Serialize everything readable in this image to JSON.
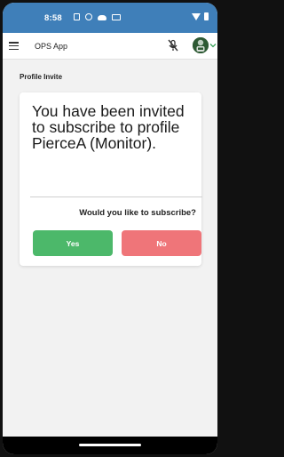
{
  "status_bar": {
    "time": "8:58",
    "icons": [
      "sim-icon",
      "circle-icon",
      "cloud-icon",
      "card-icon",
      "wifi-icon",
      "battery-icon"
    ]
  },
  "app_bar": {
    "title": "OPS App",
    "icons": [
      "menu-icon",
      "mic-off-icon",
      "avatar",
      "chevron-down-icon"
    ]
  },
  "page": {
    "section_title": "Profile Invite",
    "card": {
      "message": "You have been invited to subscribe to profile PierceA (Monitor).",
      "question": "Would you like to subscribe?",
      "yes_label": "Yes",
      "no_label": "No"
    }
  },
  "colors": {
    "status_bar": "#3f7fb9",
    "yes_button": "#4cb86a",
    "no_button": "#ef7579",
    "page_bg": "#f2f2f2"
  }
}
